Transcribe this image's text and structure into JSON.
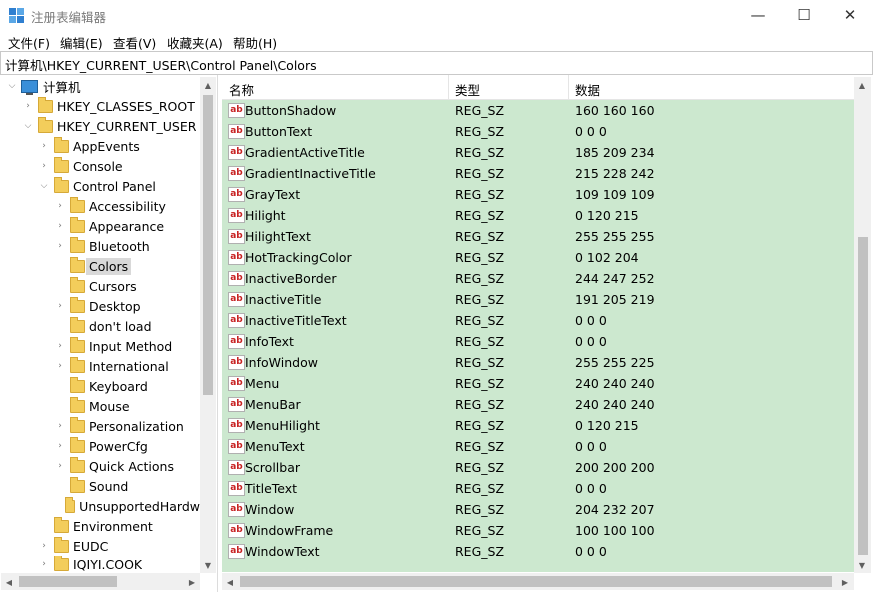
{
  "window": {
    "title": "注册表编辑器",
    "minimize": "—",
    "maximize": "☐",
    "close": "✕"
  },
  "menu": [
    "文件(F)",
    "编辑(E)",
    "查看(V)",
    "收藏夹(A)",
    "帮助(H)"
  ],
  "address": "计算机\\HKEY_CURRENT_USER\\Control Panel\\Colors",
  "tree": {
    "root": "计算机",
    "hkcr": "HKEY_CLASSES_ROOT",
    "hkcu": "HKEY_CURRENT_USER",
    "appevents": "AppEvents",
    "console": "Console",
    "control_panel": "Control Panel",
    "accessibility": "Accessibility",
    "appearance": "Appearance",
    "bluetooth": "Bluetooth",
    "colors": "Colors",
    "cursors": "Cursors",
    "desktop": "Desktop",
    "dontload": "don't load",
    "input_method": "Input Method",
    "international": "International",
    "keyboard": "Keyboard",
    "mouse": "Mouse",
    "personalization": "Personalization",
    "powercfg": "PowerCfg",
    "quick_actions": "Quick Actions",
    "sound": "Sound",
    "unsupported": "UnsupportedHardw",
    "environment": "Environment",
    "eudc": "EUDC",
    "iqiyi": "IQIYI.COOK"
  },
  "columns": {
    "name": "名称",
    "type": "类型",
    "data": "数据"
  },
  "values": [
    {
      "name": "ButtonShadow",
      "type": "REG_SZ",
      "data": "160 160 160"
    },
    {
      "name": "ButtonText",
      "type": "REG_SZ",
      "data": "0 0 0"
    },
    {
      "name": "GradientActiveTitle",
      "type": "REG_SZ",
      "data": "185 209 234"
    },
    {
      "name": "GradientInactiveTitle",
      "type": "REG_SZ",
      "data": "215 228 242"
    },
    {
      "name": "GrayText",
      "type": "REG_SZ",
      "data": "109 109 109"
    },
    {
      "name": "Hilight",
      "type": "REG_SZ",
      "data": "0 120 215"
    },
    {
      "name": "HilightText",
      "type": "REG_SZ",
      "data": "255 255 255"
    },
    {
      "name": "HotTrackingColor",
      "type": "REG_SZ",
      "data": "0 102 204"
    },
    {
      "name": "InactiveBorder",
      "type": "REG_SZ",
      "data": "244 247 252"
    },
    {
      "name": "InactiveTitle",
      "type": "REG_SZ",
      "data": "191 205 219"
    },
    {
      "name": "InactiveTitleText",
      "type": "REG_SZ",
      "data": "0 0 0"
    },
    {
      "name": "InfoText",
      "type": "REG_SZ",
      "data": "0 0 0"
    },
    {
      "name": "InfoWindow",
      "type": "REG_SZ",
      "data": "255 255 225"
    },
    {
      "name": "Menu",
      "type": "REG_SZ",
      "data": "240 240 240"
    },
    {
      "name": "MenuBar",
      "type": "REG_SZ",
      "data": "240 240 240"
    },
    {
      "name": "MenuHilight",
      "type": "REG_SZ",
      "data": "0 120 215"
    },
    {
      "name": "MenuText",
      "type": "REG_SZ",
      "data": "0 0 0"
    },
    {
      "name": "Scrollbar",
      "type": "REG_SZ",
      "data": "200 200 200"
    },
    {
      "name": "TitleText",
      "type": "REG_SZ",
      "data": "0 0 0"
    },
    {
      "name": "Window",
      "type": "REG_SZ",
      "data": "204 232 207"
    },
    {
      "name": "WindowFrame",
      "type": "REG_SZ",
      "data": "100 100 100"
    },
    {
      "name": "WindowText",
      "type": "REG_SZ",
      "data": "0 0 0"
    }
  ],
  "value_icon": "ab",
  "colors": {
    "selection_bg": "#cce8cf",
    "folder": "#f3cd5b"
  }
}
